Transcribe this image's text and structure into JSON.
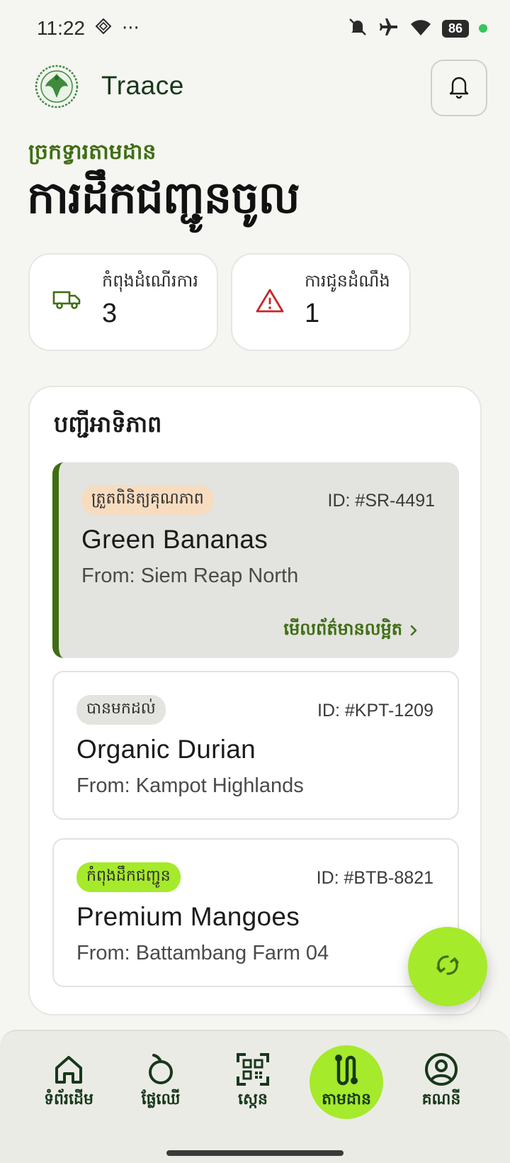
{
  "status_bar": {
    "time": "11:22",
    "more": "···",
    "battery": "86"
  },
  "header": {
    "app_name": "Traace"
  },
  "page": {
    "eyebrow": "ច្រកទ្វារតាមដាន",
    "title": "ការដឹកជញ្ជូនចូល"
  },
  "stats": [
    {
      "label": "កំពុងដំណើរការ",
      "value": "3",
      "icon": "truck-icon"
    },
    {
      "label": "ការជូនដំណឹង",
      "value": "1",
      "icon": "warning-icon"
    }
  ],
  "registry": {
    "title": "បញ្ជីអាទិភាព",
    "shipments": [
      {
        "badge": "ត្រួតពិនិត្យគុណភាព",
        "badge_color": "#f7dcc0",
        "id": "ID: #SR-4491",
        "name": "Green Bananas",
        "origin": "From: Siem Reap North",
        "link": "មើលព័ត៌មានលម្អិត"
      },
      {
        "badge": "បានមកដល់",
        "badge_color": "#e3e3df",
        "id": "ID: #KPT-1209",
        "name": "Organic Durian",
        "origin": "From: Kampot Highlands"
      },
      {
        "badge": "កំពុងដឹកជញ្ជូន",
        "badge_color": "#a5ea2b",
        "id": "ID: #BTB-8821",
        "name": "Premium Mangoes",
        "origin": "From: Battambang Farm 04"
      }
    ]
  },
  "nav": [
    {
      "label": "ទំព័រដើម",
      "icon": "home-icon"
    },
    {
      "label": "ផ្លែឈើ",
      "icon": "fruit-icon"
    },
    {
      "label": "ស្កេន",
      "icon": "qr-scan-icon"
    },
    {
      "label": "តាមដាន",
      "icon": "route-icon",
      "active": true
    },
    {
      "label": "គណនី",
      "icon": "account-icon"
    }
  ],
  "colors": {
    "accent_green": "#3f6e12",
    "lime": "#a5ea2b",
    "alert_red": "#c62828"
  }
}
